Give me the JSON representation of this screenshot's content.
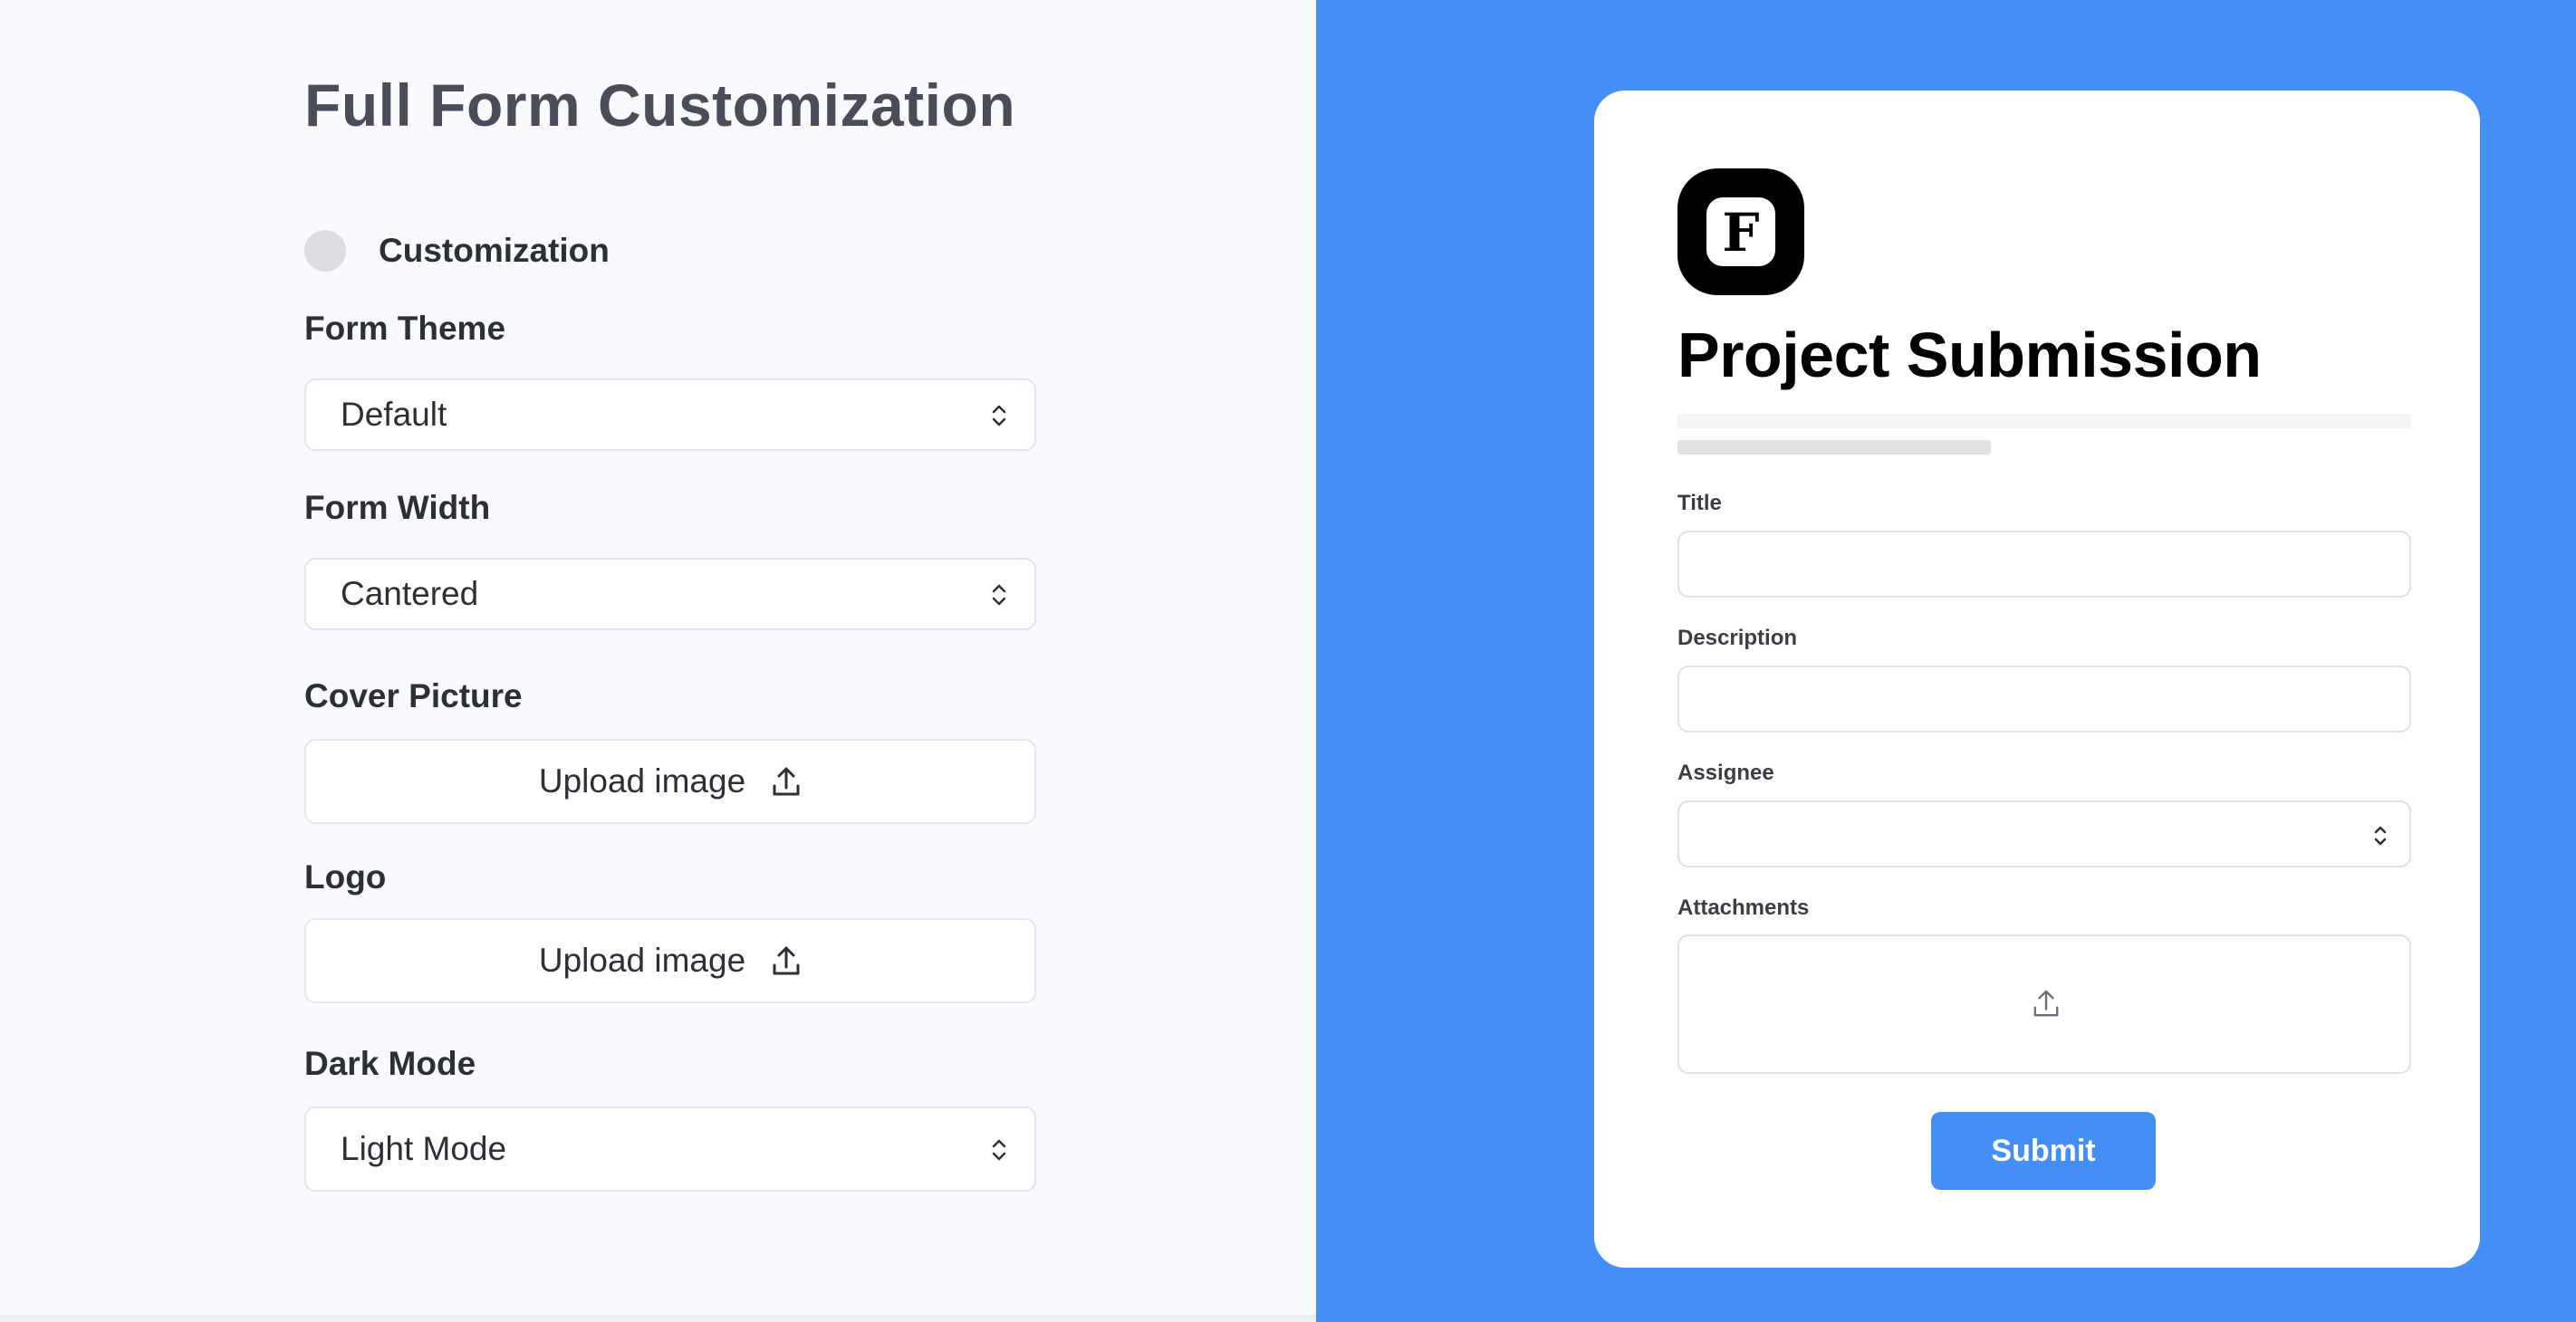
{
  "settings": {
    "title": "Full Form Customization",
    "customization_toggle": {
      "label": "Customization",
      "enabled": false
    },
    "form_theme": {
      "label": "Form Theme",
      "value": "Default"
    },
    "form_width": {
      "label": "Form Width",
      "value": "Cantered"
    },
    "cover_picture": {
      "label": "Cover Picture",
      "button": "Upload image"
    },
    "logo": {
      "label": "Logo",
      "button": "Upload image"
    },
    "dark_mode": {
      "label": "Dark Mode",
      "value": "Light Mode"
    }
  },
  "preview": {
    "logo_letter": "F",
    "title": "Project Submission",
    "fields": {
      "title": {
        "label": "Title"
      },
      "description": {
        "label": "Description"
      },
      "assignee": {
        "label": "Assignee"
      },
      "attachments": {
        "label": "Attachments"
      }
    },
    "submit_label": "Submit"
  },
  "colors": {
    "accent": "#448ff6",
    "left_background": "#f8fafd",
    "heading_text": "#4a4c57"
  },
  "icons": {
    "select": "chevron-up-down-icon",
    "upload": "upload-icon"
  }
}
